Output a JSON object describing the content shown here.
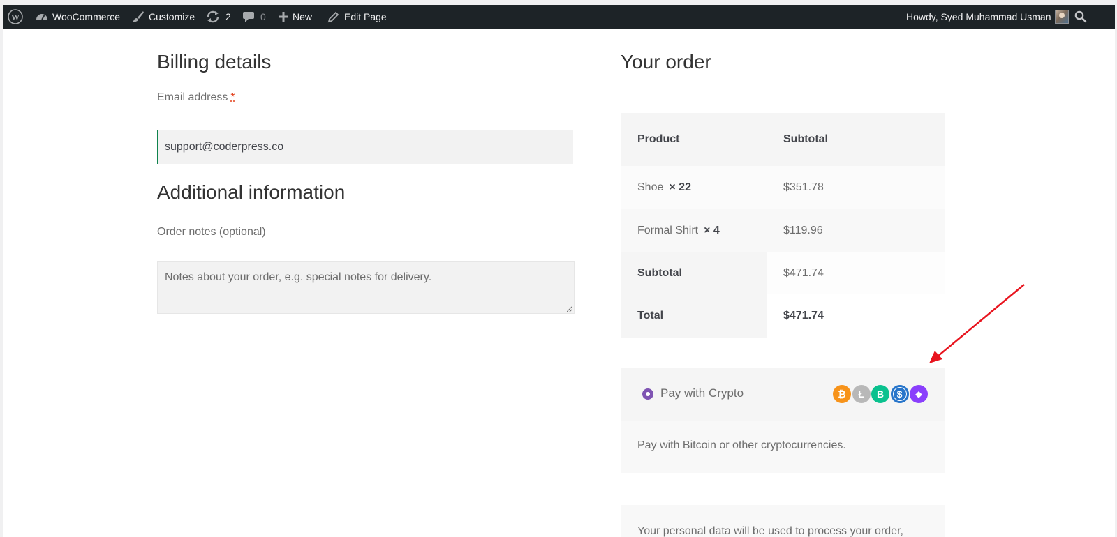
{
  "admin_bar": {
    "site_menu": "WooCommerce",
    "customize": "Customize",
    "updates_count": "2",
    "comments_count": "0",
    "new": "New",
    "edit_page": "Edit Page",
    "howdy": "Howdy, Syed Muhammad Usman"
  },
  "billing": {
    "title": "Billing details",
    "email_label": "Email address",
    "email_required": "*",
    "email_value": "support@coderpress.co"
  },
  "additional": {
    "title": "Additional information",
    "notes_label": "Order notes (optional)",
    "notes_placeholder": "Notes about your order, e.g. special notes for delivery."
  },
  "order": {
    "title": "Your order",
    "headers": {
      "product": "Product",
      "subtotal": "Subtotal"
    },
    "items": [
      {
        "name": "Shoe",
        "qty": "× 22",
        "subtotal": "$351.78"
      },
      {
        "name": "Formal Shirt",
        "qty": "× 4",
        "subtotal": "$119.96"
      }
    ],
    "subtotal_label": "Subtotal",
    "subtotal_value": "$471.74",
    "total_label": "Total",
    "total_value": "$471.74"
  },
  "payment": {
    "method_label": "Pay with Crypto",
    "description": "Pay with Bitcoin or other cryptocurrencies.",
    "coins": [
      {
        "icon": "bitcoin-icon",
        "glyph": "₿",
        "color": "#f7931a"
      },
      {
        "icon": "litecoin-icon",
        "glyph": "Ł",
        "color": "#b8b8b8"
      },
      {
        "icon": "bitcoin-cash-icon",
        "glyph": "B",
        "color": "#0ac18e"
      },
      {
        "icon": "usdc-icon",
        "glyph": "$",
        "color": "#2775ca"
      },
      {
        "icon": "ethereum-icon",
        "glyph": "◆",
        "color": "#8a3ffc"
      }
    ]
  },
  "privacy_text": "Your personal data will be used to process your order, support your experience throughout this website, and for",
  "colors": {
    "admin_bar_bg": "#1d2327",
    "accent_purple": "#7f54b3",
    "field_focus_green": "#0f834d",
    "annotation_arrow": "#e8141e"
  }
}
